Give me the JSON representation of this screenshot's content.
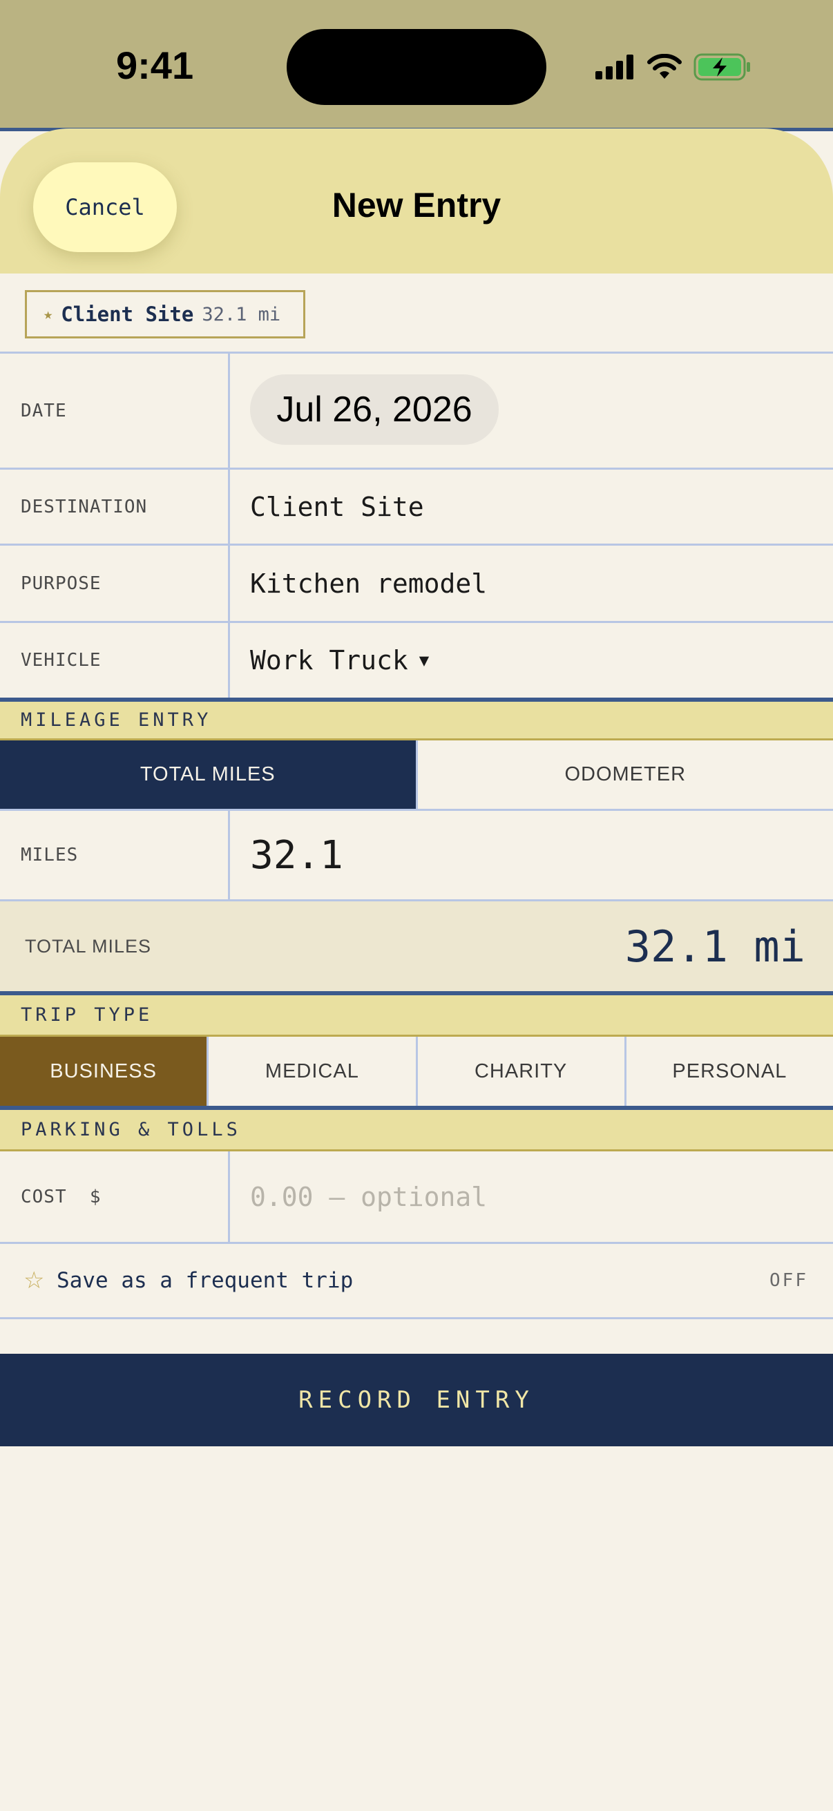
{
  "status_bar": {
    "time": "9:41"
  },
  "header": {
    "cancel_label": "Cancel",
    "title": "New Entry"
  },
  "frequent_chip": {
    "icon": "star-icon",
    "name": "Client Site",
    "distance": "32.1 mi"
  },
  "form": {
    "date": {
      "label": "DATE",
      "value": "Jul 26, 2026"
    },
    "destination": {
      "label": "DESTINATION",
      "value": "Client Site"
    },
    "purpose": {
      "label": "PURPOSE",
      "value": "Kitchen remodel"
    },
    "vehicle": {
      "label": "VEHICLE",
      "value": "Work Truck",
      "caret": "▼"
    }
  },
  "mileage_entry": {
    "section_label": "MILEAGE ENTRY",
    "modes": [
      "TOTAL MILES",
      "ODOMETER"
    ],
    "selected_mode": "TOTAL MILES",
    "miles_label": "MILES",
    "miles_value": "32.1",
    "total_label": "TOTAL MILES",
    "total_value": "32.1 mi"
  },
  "trip_type": {
    "section_label": "TRIP TYPE",
    "options": [
      "BUSINESS",
      "MEDICAL",
      "CHARITY",
      "PERSONAL"
    ],
    "selected": "BUSINESS"
  },
  "parking_tolls": {
    "section_label": "PARKING & TOLLS",
    "cost_label": "COST  $",
    "cost_placeholder": "0.00 — optional"
  },
  "frequent_toggle": {
    "label": "Save as a frequent trip",
    "state": "OFF"
  },
  "submit": {
    "label": "RECORD ENTRY"
  },
  "colors": {
    "navy": "#1c2e50",
    "cream": "#f6f2e8",
    "header_yellow": "#e9e0a0",
    "business_brown": "#7a5a1e",
    "accent_blue": "#3c5a8c",
    "battery_green": "#4cc45a"
  }
}
